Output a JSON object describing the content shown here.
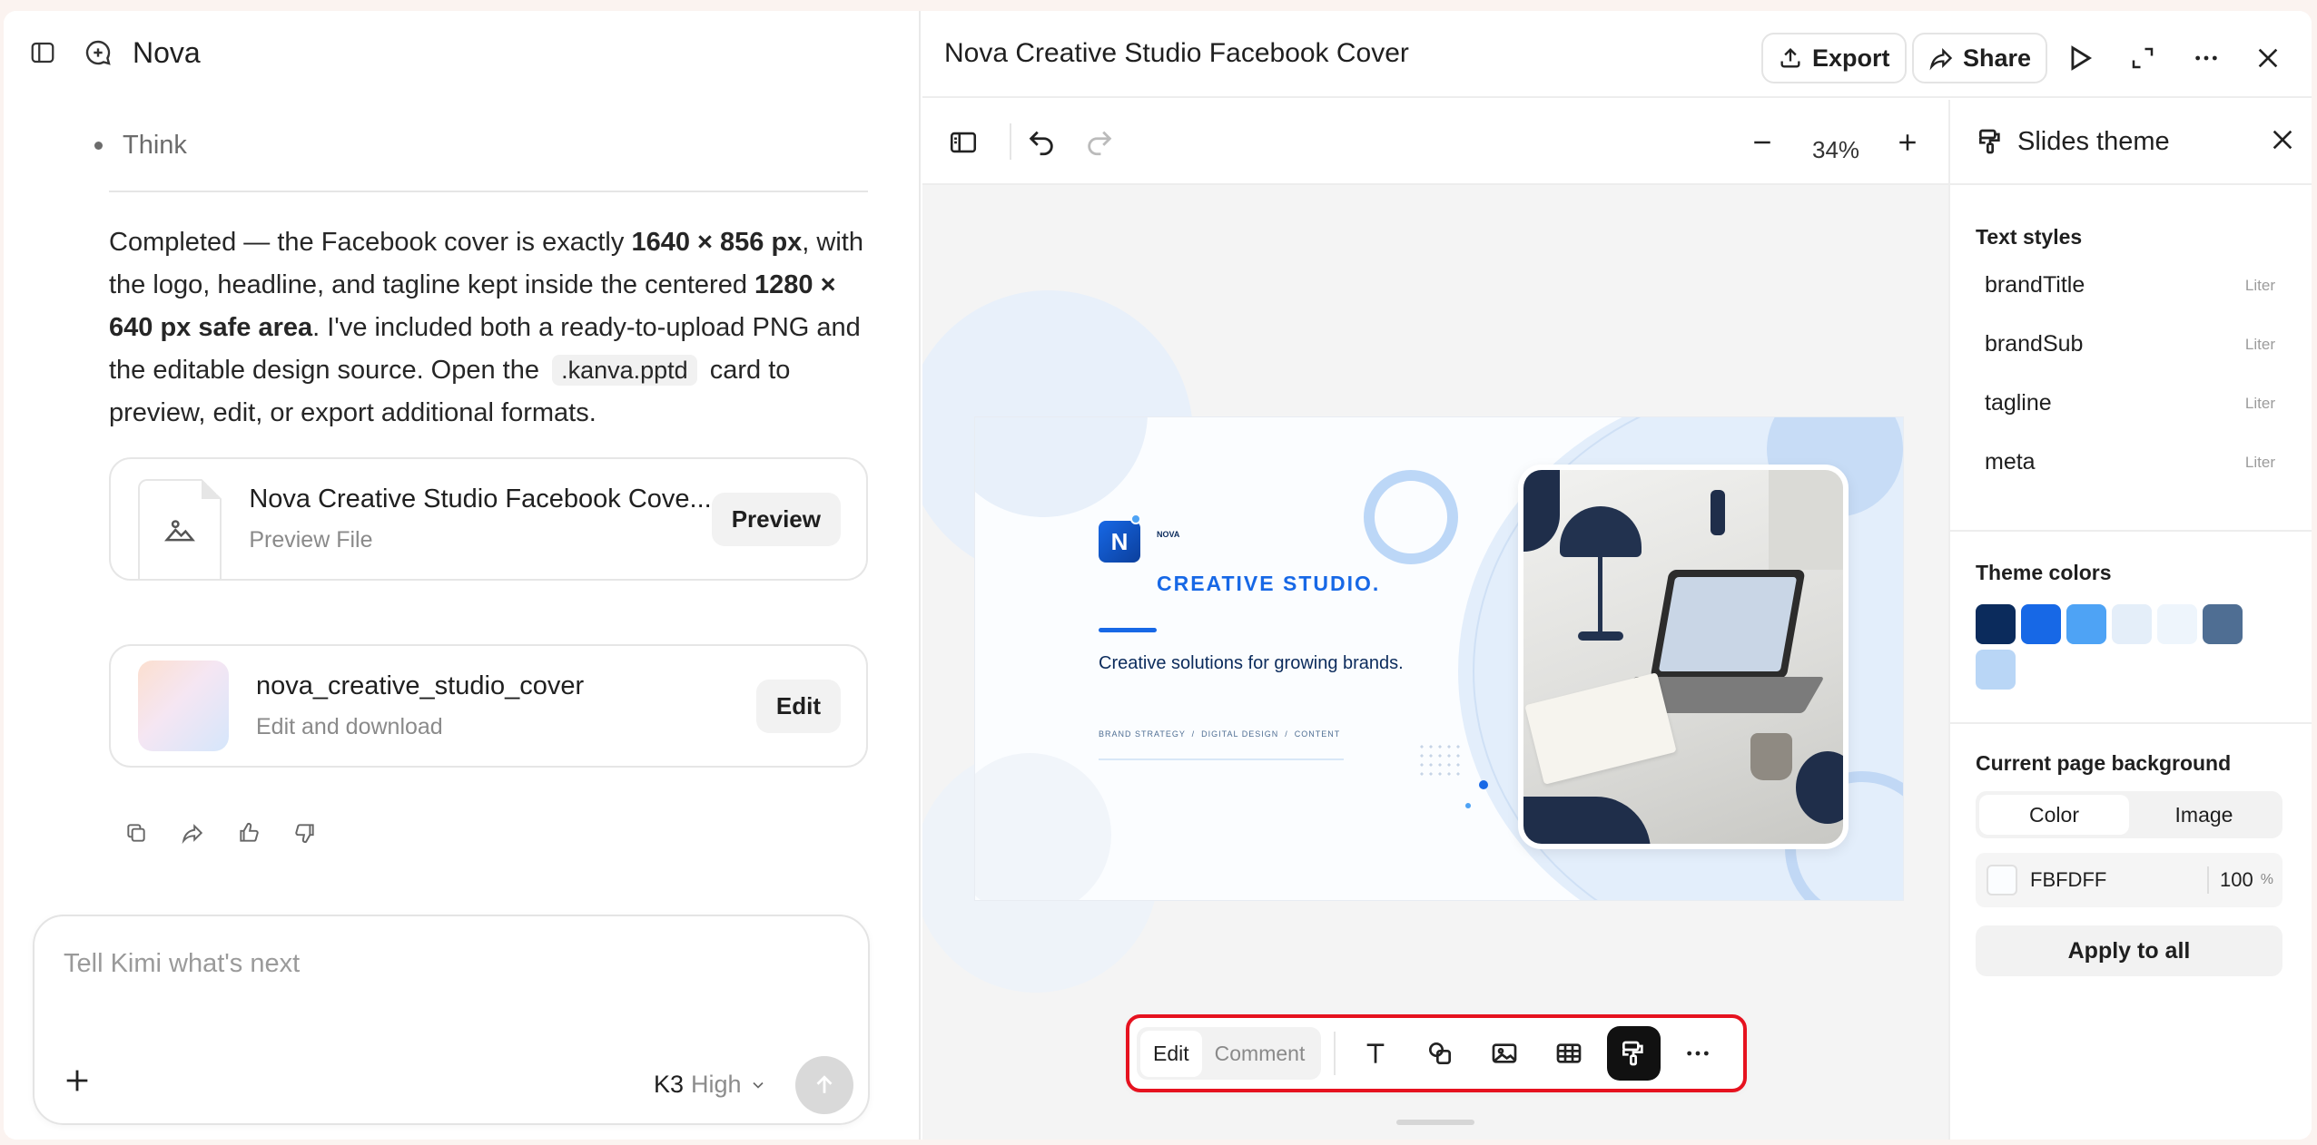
{
  "chat": {
    "title": "Nova",
    "bullet": "Think",
    "message": {
      "p1": "Completed — the Facebook cover is exactly ",
      "b1": "1640 × 856 px",
      "p2": ", with the logo, headline, and tagline kept inside the centered ",
      "b2": "1280 × 640 px safe area",
      "p3": ". I've included both a ready-to-upload PNG and the editable design source. Open the ",
      "code": ".kanva.pptd",
      "p4": " card to preview, edit, or export additional formats."
    },
    "file_card": {
      "title": "Nova Creative Studio Facebook Cove...",
      "subtitle": "Preview File",
      "button": "Preview"
    },
    "design_card": {
      "title": "nova_creative_studio_cover",
      "subtitle": "Edit and download",
      "button": "Edit"
    },
    "composer": {
      "placeholder": "Tell Kimi what's next",
      "model": "K3",
      "mode": "High"
    }
  },
  "editor": {
    "title": "Nova Creative Studio Facebook Cover",
    "export_label": "Export",
    "share_label": "Share",
    "zoom": "34%"
  },
  "slide": {
    "logo_letter": "N",
    "brand_small": "NOVA",
    "headline": "CREATIVE STUDIO.",
    "tagline": "Creative solutions for growing brands.",
    "meta": "BRAND STRATEGY  /  DIGITAL DESIGN  /  CONTENT"
  },
  "floatbar": {
    "edit": "Edit",
    "comment": "Comment"
  },
  "theme": {
    "title": "Slides theme",
    "text_styles_label": "Text styles",
    "text_styles": [
      {
        "name": "brandTitle",
        "font": "Liter"
      },
      {
        "name": "brandSub",
        "font": "Liter"
      },
      {
        "name": "tagline",
        "font": "Liter"
      },
      {
        "name": "meta",
        "font": "Liter"
      }
    ],
    "colors_label": "Theme colors",
    "colors": [
      "#0b2b5c",
      "#1768e6",
      "#4ea3f5",
      "#e4eef9",
      "#eef5fc",
      "#4f6e93",
      "#b9d6f6"
    ],
    "bg_label": "Current page background",
    "bg_tabs": [
      "Color",
      "Image"
    ],
    "bg_hex": "FBFDFF",
    "bg_opacity": "100",
    "opacity_unit": "%",
    "apply": "Apply to all"
  }
}
